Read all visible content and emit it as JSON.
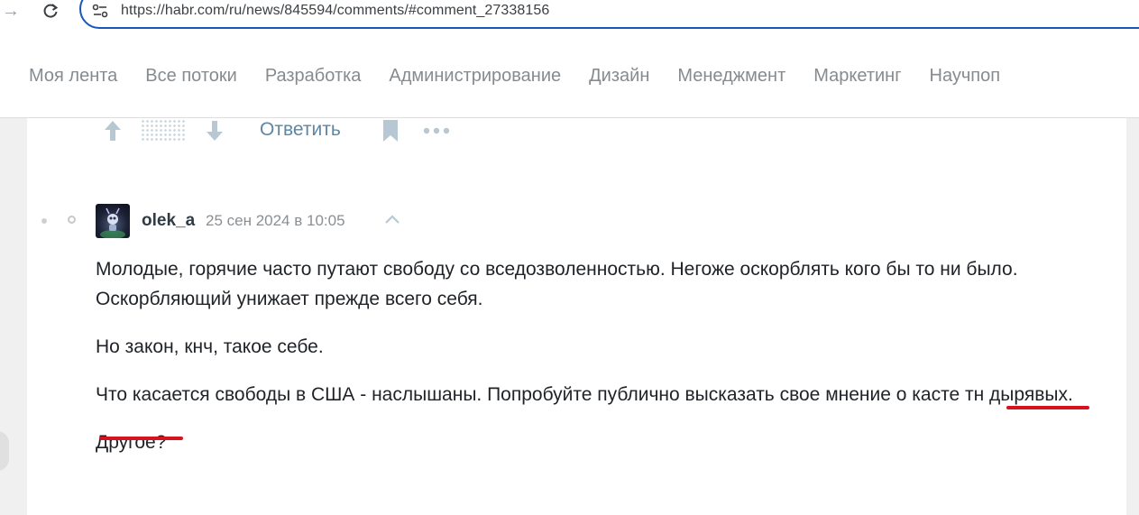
{
  "browser": {
    "url": "https://habr.com/ru/news/845594/comments/#comment_27338156"
  },
  "nav": {
    "items": [
      "Моя лента",
      "Все потоки",
      "Разработка",
      "Администрирование",
      "Дизайн",
      "Менеджмент",
      "Маркетинг",
      "Научпоп"
    ]
  },
  "prev_comment_actions": {
    "reply_label": "Ответить"
  },
  "comment": {
    "username": "olek_a",
    "timestamp": "25 сен 2024 в 10:05",
    "paragraphs": [
      "Молодые, горячие часто путают свободу со вседозволенностью. Негоже оскорблять кого бы то ни было. Оскорбляющий унижает прежде всего себя.",
      "Но закон, кнч, такое себе.",
      "Что касается свободы в США - наслышаны. Попробуйте публично высказать свое мнение о касте тн дырявых.",
      "Другое?"
    ]
  },
  "colors": {
    "accent_link": "#5e87a3",
    "omnibox_border": "#1a57b8",
    "annotation_underline": "#d6121f"
  }
}
